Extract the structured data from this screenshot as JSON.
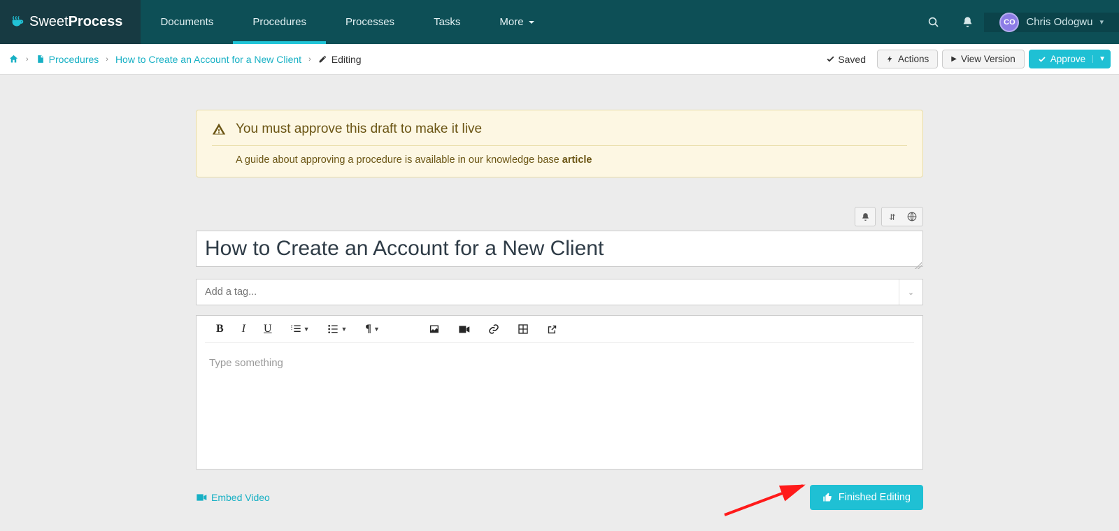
{
  "brand": {
    "part1": "Sweet",
    "part2": "Process"
  },
  "nav": {
    "items": [
      {
        "label": "Documents"
      },
      {
        "label": "Procedures",
        "active": true
      },
      {
        "label": "Processes"
      },
      {
        "label": "Tasks"
      },
      {
        "label": "More"
      }
    ]
  },
  "user": {
    "initials": "CO",
    "name": "Chris Odogwu"
  },
  "breadcrumb": {
    "procedures_label": "Procedures",
    "doc_label": "How to Create an Account for a New Client",
    "editing_label": "Editing"
  },
  "status": {
    "saved_label": "Saved"
  },
  "actions": {
    "actions_label": "Actions",
    "view_version_label": "View Version",
    "approve_label": "Approve"
  },
  "alert": {
    "title": "You must approve this draft to make it live",
    "sub_pre": "A guide about approving a procedure is available in our knowledge base ",
    "sub_link": "article"
  },
  "title_field": {
    "value": "How to Create an Account for a New Client"
  },
  "tag_field": {
    "placeholder": "Add a tag..."
  },
  "editor": {
    "placeholder": "Type something"
  },
  "footer": {
    "embed_label": "Embed Video",
    "finish_label": "Finished Editing"
  }
}
